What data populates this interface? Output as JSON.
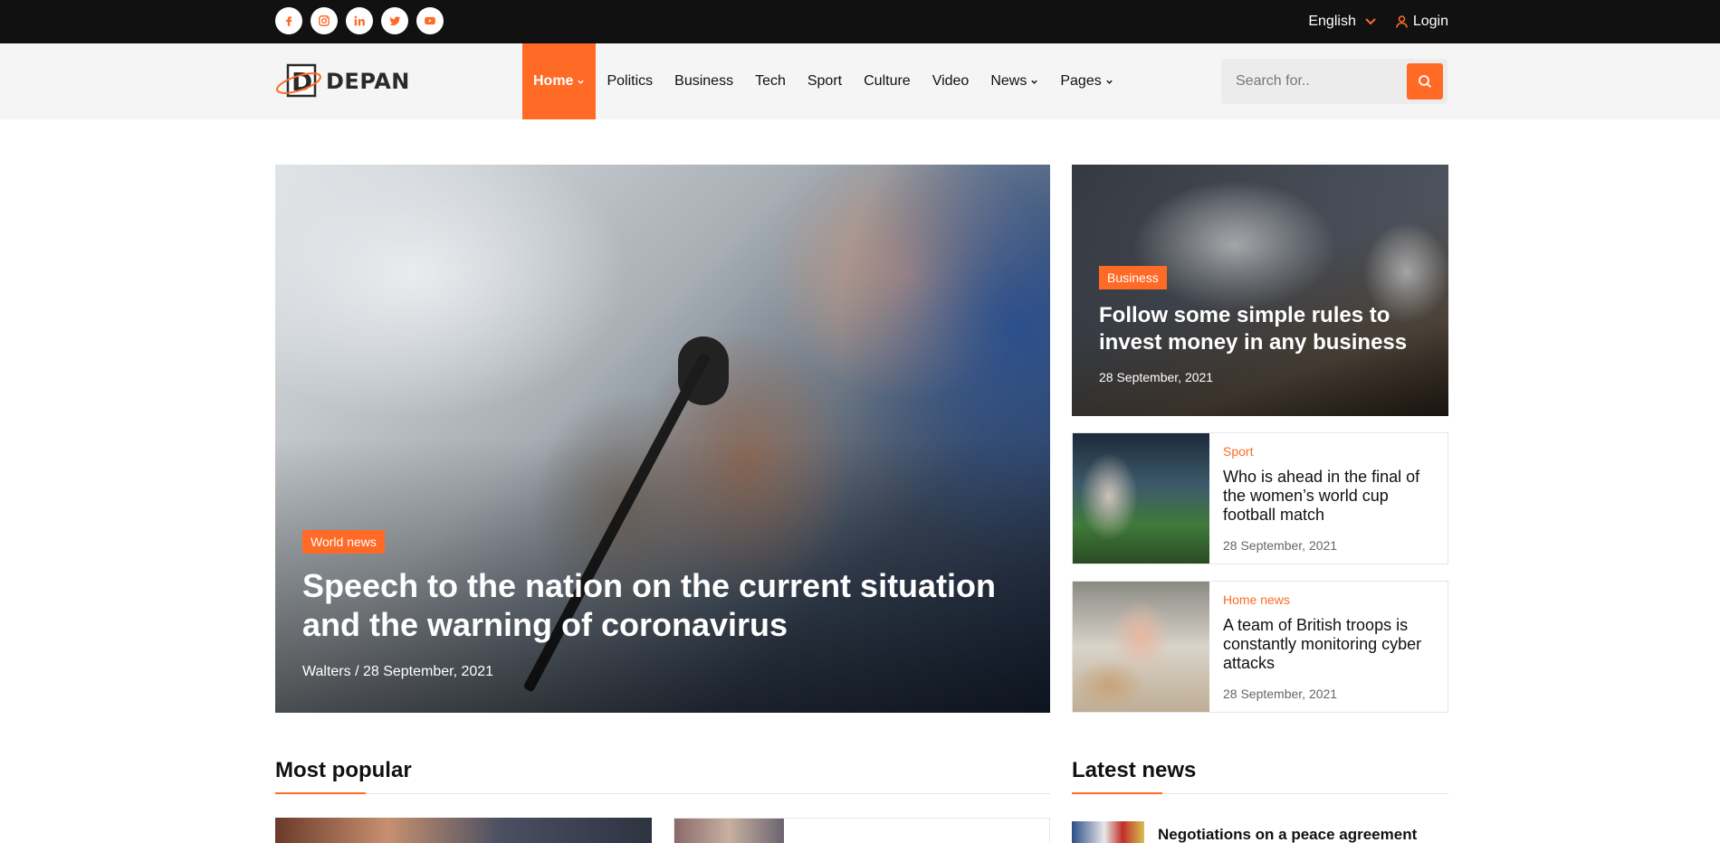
{
  "topbar": {
    "socials": [
      {
        "icon": "facebook-icon"
      },
      {
        "icon": "instagram-icon"
      },
      {
        "icon": "linkedin-icon"
      },
      {
        "icon": "twitter-icon"
      },
      {
        "icon": "youtube-icon"
      }
    ],
    "language": "English",
    "login": "Login"
  },
  "header": {
    "logo_text": "DEPAN",
    "logo_letter": "D",
    "nav": [
      {
        "label": "Home",
        "active": true,
        "dropdown": true
      },
      {
        "label": "Politics"
      },
      {
        "label": "Business"
      },
      {
        "label": "Tech"
      },
      {
        "label": "Sport"
      },
      {
        "label": "Culture"
      },
      {
        "label": "Video"
      },
      {
        "label": "News",
        "dropdown": true
      },
      {
        "label": "Pages",
        "dropdown": true
      }
    ],
    "search_placeholder": "Search for.."
  },
  "hero": {
    "category": "World news",
    "title": "Speech to the nation on the current situation and the warning of coronavirus",
    "meta": "Walters / 28 September, 2021"
  },
  "side_big": {
    "category": "Business",
    "title": "Follow some simple rules to invest money in any business",
    "date": "28 September, 2021"
  },
  "side_cards": [
    {
      "category": "Sport",
      "title": "Who is ahead in the final of the women’s world cup football match",
      "date": "28 September, 2021"
    },
    {
      "category": "Home news",
      "title": "A team of British troops is constantly monitoring cyber attacks",
      "date": "28 September, 2021"
    }
  ],
  "sections": {
    "most_popular": "Most popular",
    "latest_news": "Latest news"
  },
  "latest_news_first": "Negotiations on a peace agreement",
  "colors": {
    "accent": "#ff6a26",
    "topbar": "#111111",
    "header": "#f5f5f5"
  }
}
